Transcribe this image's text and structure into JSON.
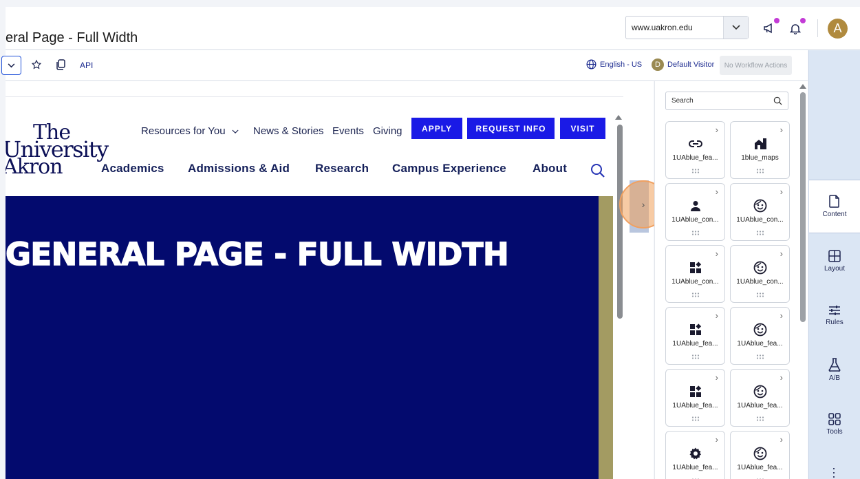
{
  "header": {
    "page_title": "eral Page - Full Width",
    "site": "www.uakron.edu",
    "avatar_letter": "A"
  },
  "toolbar": {
    "api_label": "API",
    "language": "English - US",
    "visitor_letter": "D",
    "visitor": "Default Visitor",
    "workflow": "No Workflow Actions"
  },
  "site_preview": {
    "logo": {
      "line1": "The",
      "line2": "University",
      "line3": "Akron"
    },
    "utility_nav": {
      "resources": "Resources for You",
      "news": "News & Stories",
      "events": "Events",
      "giving": "Giving"
    },
    "cta": {
      "apply": "APPLY",
      "request": "REQUEST INFO",
      "visit": "VISIT"
    },
    "main_nav": {
      "academics": "Academics",
      "admissions": "Admissions & Aid",
      "research": "Research",
      "campus": "Campus Experience",
      "about": "About"
    },
    "hero_title": "GENERAL PAGE - FULL WIDTH"
  },
  "panel": {
    "search_placeholder": "Search",
    "components": [
      {
        "label": "1UAblue_fea...",
        "icon": "link-icon"
      },
      {
        "label": "1blue_maps",
        "icon": "map-building-icon"
      },
      {
        "label": "1UAblue_con...",
        "icon": "person-icon"
      },
      {
        "label": "1UAblue_con...",
        "icon": "face-icon"
      },
      {
        "label": "1UAblue_con...",
        "icon": "widgets-icon"
      },
      {
        "label": "1UAblue_con...",
        "icon": "face-icon"
      },
      {
        "label": "1UAblue_fea...",
        "icon": "widgets-icon"
      },
      {
        "label": "1UAblue_fea...",
        "icon": "face-icon"
      },
      {
        "label": "1UAblue_fea...",
        "icon": "widgets-icon"
      },
      {
        "label": "1UAblue_fea...",
        "icon": "face-icon"
      },
      {
        "label": "1UAblue_fea...",
        "icon": "gear-icon"
      },
      {
        "label": "1UAblue_fea...",
        "icon": "face-icon"
      }
    ]
  },
  "rail": {
    "content": "Content",
    "layout": "Layout",
    "rules": "Rules",
    "ab": "A/B",
    "tools": "Tools"
  },
  "colors": {
    "hero_blue": "#030a6e",
    "cta_blue": "#1a1ae6",
    "gold": "#a39b62",
    "notification_dot": "#c33bd6"
  }
}
